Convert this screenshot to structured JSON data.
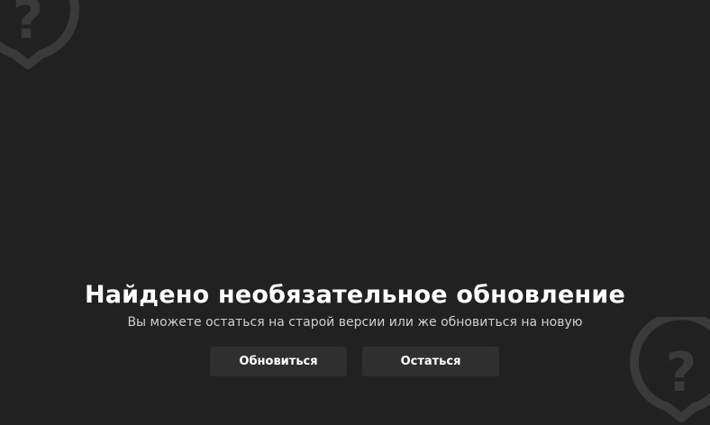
{
  "dialog": {
    "title": "Найдено необязательное обновление",
    "subtitle": "Вы можете остаться на старой версии или же обновиться на новую",
    "update_button": "Обновиться",
    "stay_button": "Остаться"
  },
  "decorations": {
    "icon": "question-bubble-icon",
    "color": "#3a3a3a"
  },
  "colors": {
    "background": "#212121",
    "button_background": "#2f2f2f",
    "title": "#ffffff",
    "subtitle": "#cfcfcf"
  }
}
